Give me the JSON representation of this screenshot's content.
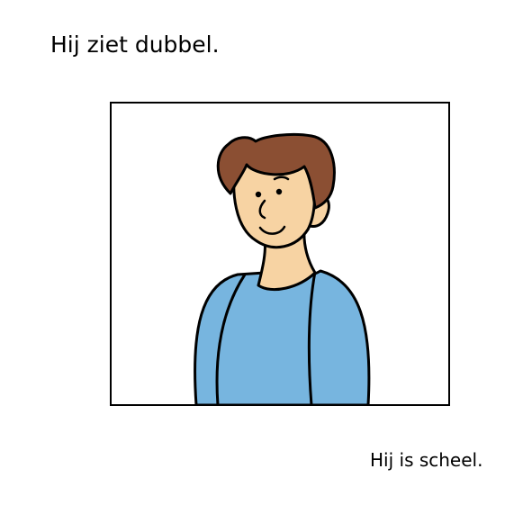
{
  "captions": {
    "top": "Hij ziet dubbel.",
    "bottom": "Hij is scheel."
  },
  "illustration": {
    "subject": "boy-portrait",
    "colors": {
      "hair": "#8B4F33",
      "skin": "#F7D3A3",
      "shirt": "#77B5DF",
      "outline": "#000000",
      "background": "#FFFFFF"
    }
  }
}
